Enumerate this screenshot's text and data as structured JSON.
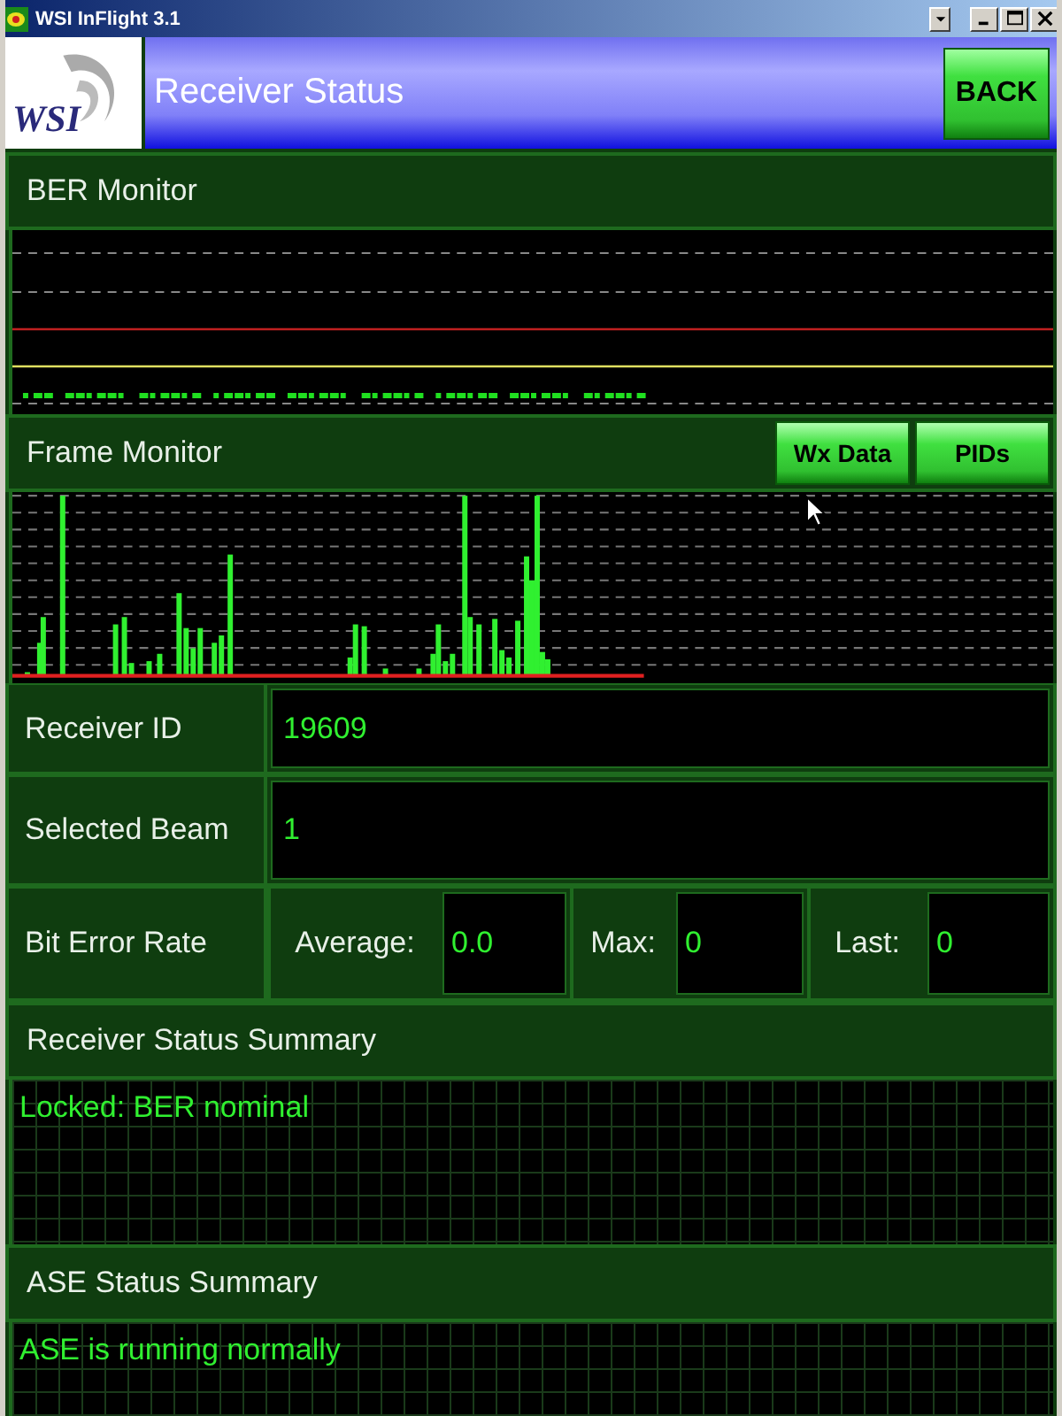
{
  "window": {
    "title": "WSI InFlight 3.1"
  },
  "header": {
    "logo": "WSI",
    "title": "Receiver Status",
    "back_button": "BACK"
  },
  "ber_monitor": {
    "title": "BER Monitor"
  },
  "frame_monitor": {
    "title": "Frame Monitor",
    "buttons": [
      "Wx Data",
      "PIDs"
    ]
  },
  "fields": [
    {
      "label": "Receiver ID",
      "value": "19609"
    },
    {
      "label": "Selected Beam",
      "value": "1"
    }
  ],
  "bit_error_rate": {
    "label": "Bit Error Rate",
    "stats": [
      {
        "label": "Average:",
        "value": "0.0"
      },
      {
        "label": "Max:",
        "value": "0"
      },
      {
        "label": "Last:",
        "value": "0"
      }
    ]
  },
  "summaries": [
    {
      "title": "Receiver Status Summary",
      "text": "Locked: BER nominal"
    },
    {
      "title": "ASE Status Summary",
      "text": "ASE is running normally"
    }
  ]
}
